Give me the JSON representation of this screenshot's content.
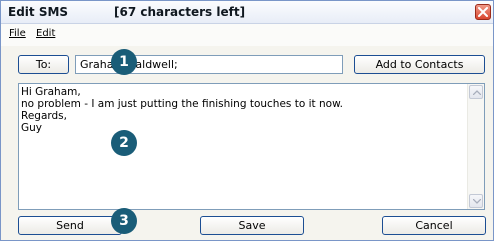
{
  "window": {
    "title": "Edit SMS",
    "char_counter": "[67 characters left]",
    "close_icon": "close-x"
  },
  "menu": {
    "file": "File",
    "edit": "Edit"
  },
  "recipient": {
    "to_label": "To:",
    "to_value": "Graham Caldwell;",
    "add_to_contacts_label": "Add to Contacts"
  },
  "message": {
    "lines": [
      "Hi Graham,",
      "no problem - I am just putting the finishing touches to it now.",
      "Regards,",
      "Guy"
    ]
  },
  "buttons": {
    "send": "Send",
    "save": "Save",
    "cancel": "Cancel"
  },
  "callouts": [
    "1",
    "2",
    "3"
  ],
  "colors": {
    "callout_bg": "#1a5d78",
    "button_border": "#1c4e93",
    "close_bg": "#d8462f"
  }
}
